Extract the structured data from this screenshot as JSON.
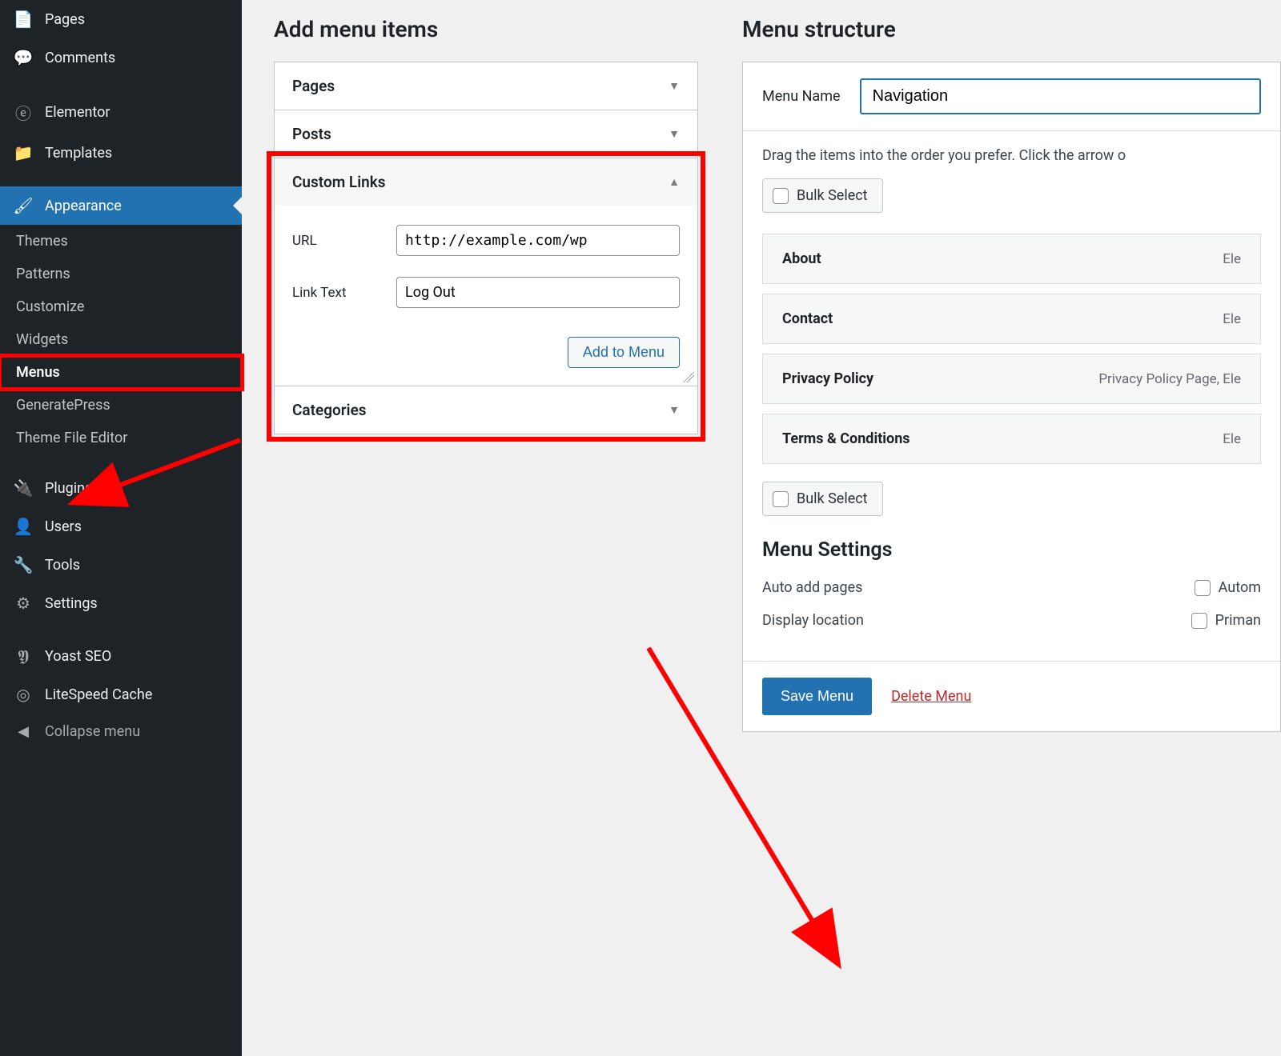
{
  "sidebar": {
    "items": [
      {
        "label": "Pages",
        "icon": "📄"
      },
      {
        "label": "Comments",
        "icon": "💬"
      },
      {
        "label": "Elementor",
        "icon": "ⓔ"
      },
      {
        "label": "Templates",
        "icon": "📁"
      },
      {
        "label": "Appearance",
        "icon": "🖌"
      },
      {
        "label": "Plugins",
        "icon": "🔌"
      },
      {
        "label": "Users",
        "icon": "👤"
      },
      {
        "label": "Tools",
        "icon": "🔧"
      },
      {
        "label": "Settings",
        "icon": "⚙"
      },
      {
        "label": "Yoast SEO",
        "icon": "𝖄"
      },
      {
        "label": "LiteSpeed Cache",
        "icon": "◎"
      }
    ],
    "appearance_sub": [
      {
        "label": "Themes"
      },
      {
        "label": "Patterns"
      },
      {
        "label": "Customize"
      },
      {
        "label": "Widgets"
      },
      {
        "label": "Menus"
      },
      {
        "label": "GeneratePress"
      },
      {
        "label": "Theme File Editor"
      }
    ],
    "collapse": "Collapse menu"
  },
  "left": {
    "title": "Add menu items",
    "panels": {
      "pages": "Pages",
      "posts": "Posts",
      "custom_links": "Custom Links",
      "categories": "Categories"
    },
    "custom": {
      "url_label": "URL",
      "url_value": "http://example.com/wp",
      "text_label": "Link Text",
      "text_value": "Log Out",
      "add_btn": "Add to Menu"
    }
  },
  "right": {
    "title": "Menu structure",
    "menu_name_label": "Menu Name",
    "menu_name_value": "Navigation",
    "instructions": "Drag the items into the order you prefer. Click the arrow o",
    "bulk_select": "Bulk Select",
    "menu_items": [
      {
        "title": "About",
        "meta": "Ele"
      },
      {
        "title": "Contact",
        "meta": "Ele"
      },
      {
        "title": "Privacy Policy",
        "meta": "Privacy Policy Page, Ele"
      },
      {
        "title": "Terms & Conditions",
        "meta": "Ele"
      }
    ],
    "settings_title": "Menu Settings",
    "auto_add_label": "Auto add pages",
    "auto_add_option": "Autom",
    "display_loc_label": "Display location",
    "display_loc_option": "Priman",
    "save_btn": "Save Menu",
    "delete_link": "Delete Menu"
  }
}
